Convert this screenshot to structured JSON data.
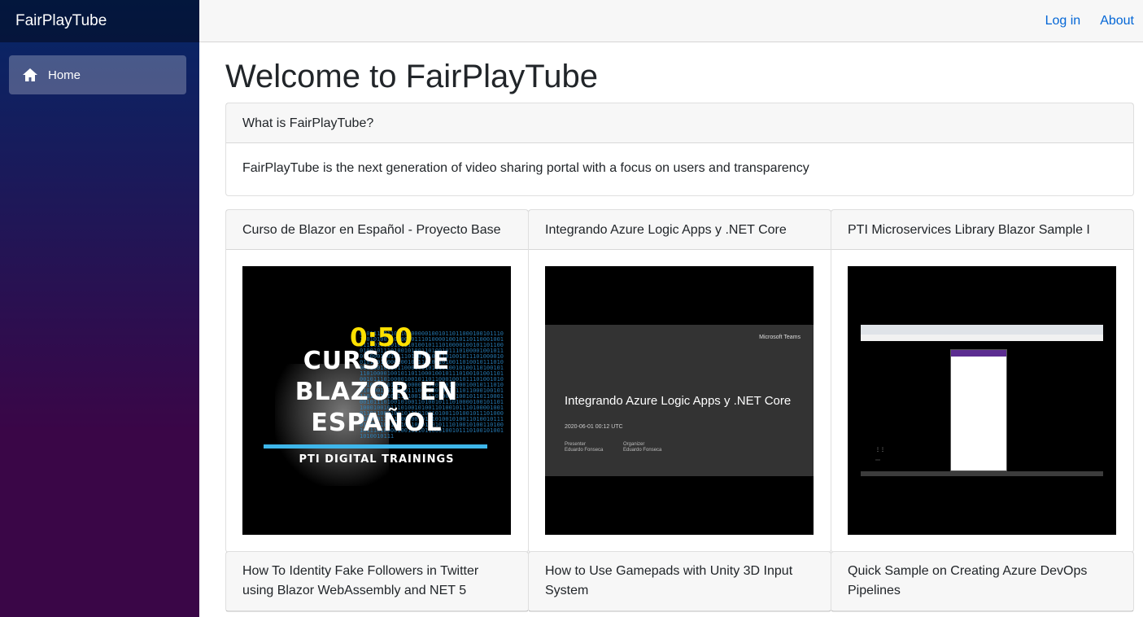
{
  "sidebar": {
    "brand": "FairPlayTube",
    "items": [
      {
        "label": "Home",
        "icon": "home-icon"
      }
    ]
  },
  "top_row": {
    "links": [
      "Log in",
      "About"
    ],
    "link_color": "#0366d6"
  },
  "page": {
    "title": "Welcome to FairPlayTube",
    "intro": {
      "header": "What is FairPlayTube?",
      "body": "FairPlayTube is the next generation of video sharing portal with a focus on users and transparency"
    }
  },
  "videos": [
    {
      "title": "Curso de Blazor en Español - Proyecto Base",
      "thumb": {
        "time": "0:50",
        "title": "CURSO DE BLAZOR EN ESPAÑOL",
        "subtitle": "PTI DIGITAL TRAININGS",
        "accent": "#ffe100"
      }
    },
    {
      "title": "Integrando Azure Logic Apps y .NET Core",
      "thumb": {
        "brand": "Microsoft Teams",
        "title": "Integrando Azure Logic Apps y .NET Core",
        "date": "2020-06-01 00:12 UTC",
        "presenter_label": "Presenter",
        "presenter": "Eduardo Fonseca",
        "organizer_label": "Organizer",
        "organizer": "Eduardo Fonseca"
      }
    },
    {
      "title": "PTI Microservices Library Blazor Sample I",
      "thumb": {}
    },
    {
      "title": "How To Identity Fake Followers in Twitter using Blazor WebAssembly and NET 5"
    },
    {
      "title": "How to Use Gamepads with Unity 3D Input System"
    },
    {
      "title": "Quick Sample on Creating Azure DevOps Pipelines"
    }
  ],
  "colors": {
    "sidebar_top": "#052767",
    "sidebar_bottom": "#3a0647",
    "thumb_bar": "#3eb6ea"
  }
}
